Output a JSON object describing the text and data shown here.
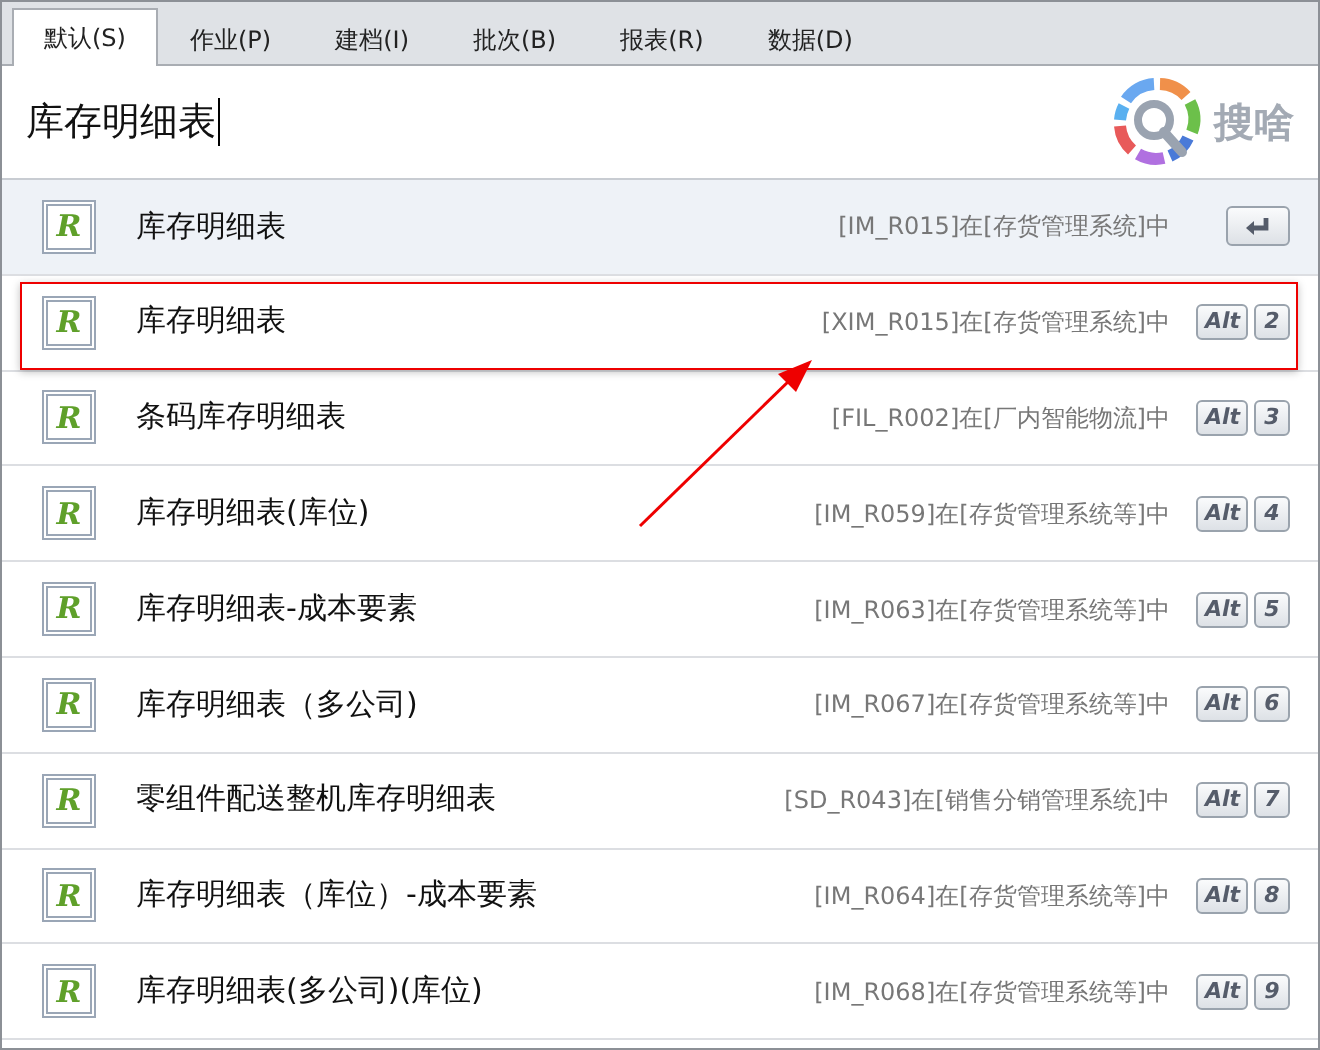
{
  "tabs": [
    {
      "label": "默认(S)",
      "selected": true
    },
    {
      "label": "作业(P)",
      "selected": false
    },
    {
      "label": "建档(I)",
      "selected": false
    },
    {
      "label": "批次(B)",
      "selected": false
    },
    {
      "label": "报表(R)",
      "selected": false
    },
    {
      "label": "数据(D)",
      "selected": false
    }
  ],
  "search": {
    "value": "库存明细表",
    "logo_text": "搜啥"
  },
  "results": [
    {
      "icon_text": "R",
      "title": "库存明细表",
      "source": "[IM_R015]在[存货管理系统]中",
      "kind": "enter",
      "selected": true,
      "annotated": false
    },
    {
      "icon_text": "R",
      "title": "库存明细表",
      "source": "[XIM_R015]在[存货管理系统]中",
      "kind": "shortcut",
      "modifier": "Alt",
      "key": "2",
      "selected": false,
      "annotated": true
    },
    {
      "icon_text": "R",
      "title": "条码库存明细表",
      "source": "[FIL_R002]在[厂内智能物流]中",
      "kind": "shortcut",
      "modifier": "Alt",
      "key": "3",
      "selected": false,
      "annotated": false
    },
    {
      "icon_text": "R",
      "title": "库存明细表(库位)",
      "source": "[IM_R059]在[存货管理系统等]中",
      "kind": "shortcut",
      "modifier": "Alt",
      "key": "4",
      "selected": false,
      "annotated": false
    },
    {
      "icon_text": "R",
      "title": "库存明细表-成本要素",
      "source": "[IM_R063]在[存货管理系统等]中",
      "kind": "shortcut",
      "modifier": "Alt",
      "key": "5",
      "selected": false,
      "annotated": false
    },
    {
      "icon_text": "R",
      "title": "库存明细表（多公司)",
      "source": "[IM_R067]在[存货管理系统等]中",
      "kind": "shortcut",
      "modifier": "Alt",
      "key": "6",
      "selected": false,
      "annotated": false
    },
    {
      "icon_text": "R",
      "title": "零组件配送整机库存明细表",
      "source": "[SD_R043]在[销售分销管理系统]中",
      "kind": "shortcut",
      "modifier": "Alt",
      "key": "7",
      "selected": false,
      "annotated": false
    },
    {
      "icon_text": "R",
      "title": "库存明细表（库位）-成本要素",
      "source": "[IM_R064]在[存货管理系统等]中",
      "kind": "shortcut",
      "modifier": "Alt",
      "key": "8",
      "selected": false,
      "annotated": false
    },
    {
      "icon_text": "R",
      "title": "库存明细表(多公司)(库位)",
      "source": "[IM_R068]在[存货管理系统等]中",
      "kind": "shortcut",
      "modifier": "Alt",
      "key": "9",
      "selected": false,
      "annotated": false
    }
  ],
  "annotation_arrow": true
}
